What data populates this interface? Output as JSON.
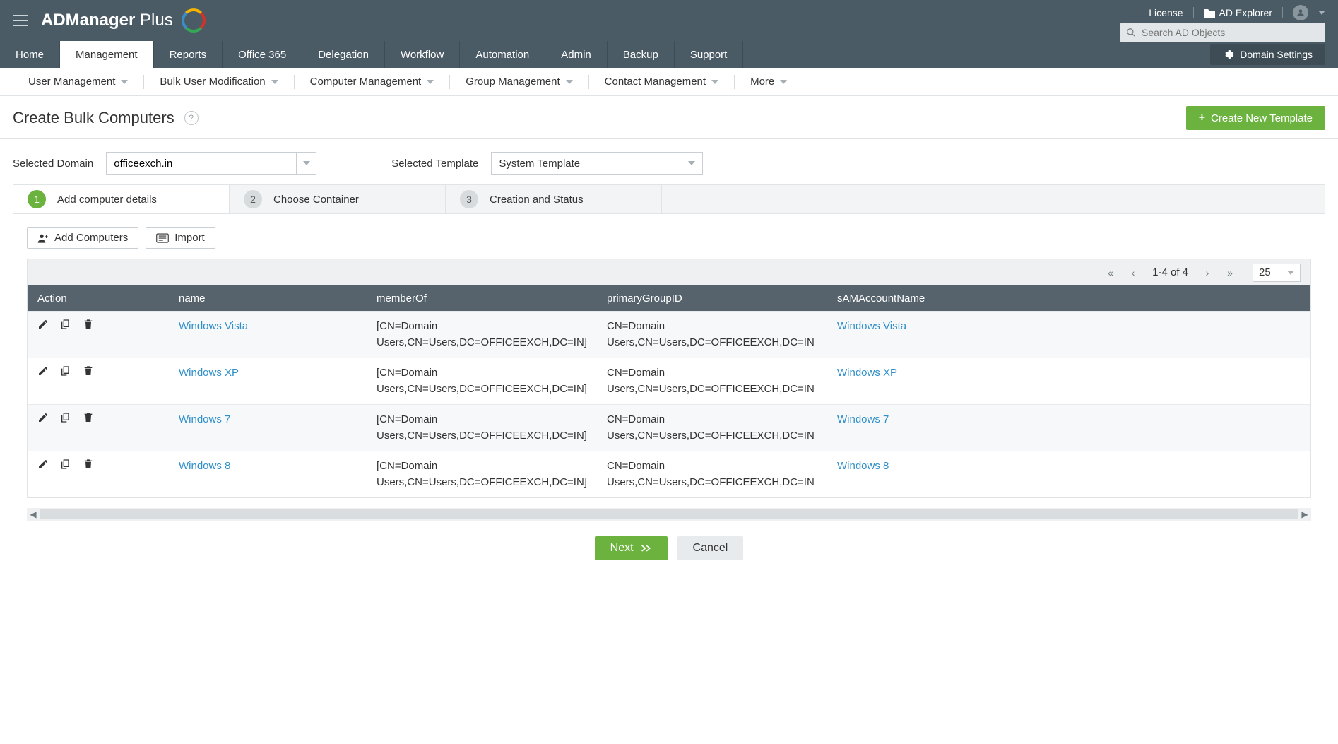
{
  "brand": {
    "a": "ADManager",
    "b": "Plus"
  },
  "topbar": {
    "license": "License",
    "explorer": "AD Explorer",
    "search_placeholder": "Search AD Objects"
  },
  "mainnav": [
    "Home",
    "Management",
    "Reports",
    "Office 365",
    "Delegation",
    "Workflow",
    "Automation",
    "Admin",
    "Backup",
    "Support"
  ],
  "mainnav_active": 1,
  "domain_settings": "Domain Settings",
  "subnav": [
    "User Management",
    "Bulk User Modification",
    "Computer Management",
    "Group Management",
    "Contact Management",
    "More"
  ],
  "page_title": "Create Bulk Computers",
  "create_template_btn": "Create New Template",
  "selected_domain_label": "Selected Domain",
  "selected_domain_value": "officeexch.in",
  "selected_template_label": "Selected Template",
  "selected_template_value": "System Template",
  "wizard": [
    {
      "n": "1",
      "label": "Add computer details"
    },
    {
      "n": "2",
      "label": "Choose Container"
    },
    {
      "n": "3",
      "label": "Creation and Status"
    }
  ],
  "toolbar": {
    "add": "Add Computers",
    "import": "Import"
  },
  "pager": {
    "info": "1-4 of 4",
    "page_size": "25"
  },
  "columns": {
    "action": "Action",
    "name": "name",
    "memberOf": "memberOf",
    "primaryGroupID": "primaryGroupID",
    "sam": "sAMAccountName"
  },
  "rows": [
    {
      "name": "Windows Vista",
      "memberOf": "[CN=Domain Users,CN=Users,DC=OFFICEEXCH,DC=IN]",
      "pg": "CN=Domain Users,CN=Users,DC=OFFICEEXCH,DC=IN",
      "sam": "Windows Vista"
    },
    {
      "name": "Windows XP",
      "memberOf": "[CN=Domain Users,CN=Users,DC=OFFICEEXCH,DC=IN]",
      "pg": "CN=Domain Users,CN=Users,DC=OFFICEEXCH,DC=IN",
      "sam": "Windows XP"
    },
    {
      "name": "Windows 7",
      "memberOf": "[CN=Domain Users,CN=Users,DC=OFFICEEXCH,DC=IN]",
      "pg": "CN=Domain Users,CN=Users,DC=OFFICEEXCH,DC=IN",
      "sam": "Windows 7"
    },
    {
      "name": "Windows 8",
      "memberOf": "[CN=Domain Users,CN=Users,DC=OFFICEEXCH,DC=IN]",
      "pg": "CN=Domain Users,CN=Users,DC=OFFICEEXCH,DC=IN",
      "sam": "Windows 8"
    }
  ],
  "footer": {
    "next": "Next",
    "cancel": "Cancel"
  }
}
